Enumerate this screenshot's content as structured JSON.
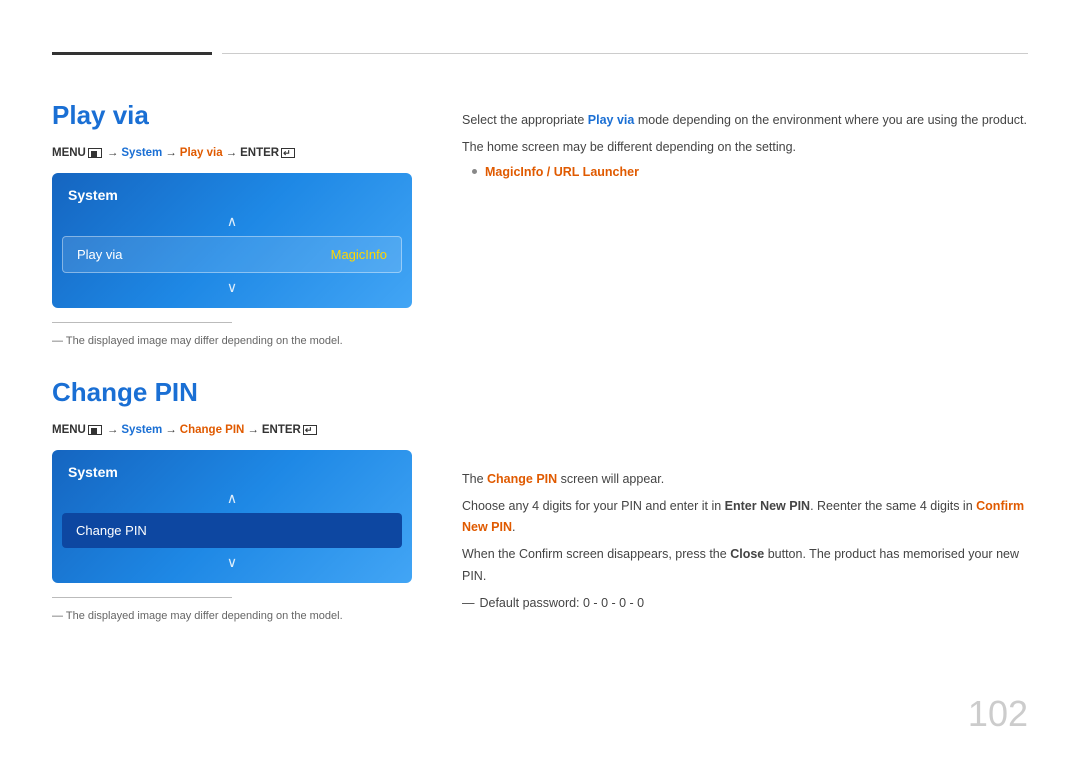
{
  "page": {
    "number": "102"
  },
  "sections": [
    {
      "id": "play-via",
      "title": "Play via",
      "menu_path": {
        "prefix": "MENU",
        "parts": [
          "System",
          "Play via",
          "ENTER"
        ]
      },
      "system_box": {
        "title": "System",
        "selected_item": {
          "label": "Play via",
          "value": "MagicInfo"
        }
      },
      "note": "The displayed image may differ depending on the model.",
      "right_content": {
        "lines": [
          "Select the appropriate Play via mode depending on the environment where you are using the product.",
          "The home screen may be different depending on the setting."
        ],
        "bullet": "MagicInfo / URL Launcher"
      }
    },
    {
      "id": "change-pin",
      "title": "Change PIN",
      "menu_path": {
        "prefix": "MENU",
        "parts": [
          "System",
          "Change PIN",
          "ENTER"
        ]
      },
      "system_box": {
        "title": "System",
        "selected_item": {
          "label": "Change PIN",
          "value": ""
        }
      },
      "note": "The displayed image may differ depending on the model.",
      "right_content": {
        "lines": [
          "The Change PIN screen will appear.",
          "Choose any 4 digits for your PIN and enter it in Enter New PIN. Reenter the same 4 digits in Confirm New PIN.",
          "When the Confirm screen disappears, press the Close button. The product has memorised your new PIN.",
          "Default password: 0 - 0 - 0 - 0"
        ]
      }
    }
  ],
  "labels": {
    "play_via_right_line1": "Select the appropriate ",
    "play_via_highlight1": "Play via",
    "play_via_right_line1b": " mode depending on the environment where you are using the product.",
    "play_via_right_line2": "The home screen may be different depending on the setting.",
    "bullet_text": "MagicInfo / URL Launcher",
    "change_pin_line1_pre": "The ",
    "change_pin_highlight1": "Change PIN",
    "change_pin_line1_post": " screen will appear.",
    "change_pin_line2_pre": "Choose any 4 digits for your PIN and enter it in ",
    "change_pin_highlight2": "Enter New PIN",
    "change_pin_line2_mid": ". Reenter the same 4 digits in ",
    "change_pin_highlight3": "Confirm New PIN",
    "change_pin_line2_post": ".",
    "change_pin_line3_pre": "When the Confirm screen disappears, press the ",
    "change_pin_highlight4": "Close",
    "change_pin_line3_post": " button. The product has memorised your new PIN.",
    "change_pin_line4": "Default password: 0 - 0 - 0 - 0",
    "menu_label": "MENU",
    "system_label": "System",
    "play_via_label": "Play via",
    "magic_info_label": "MagicInfo",
    "change_pin_label": "Change PIN",
    "enter_label": "ENTER",
    "note_text": "The displayed image may differ depending on the model."
  }
}
